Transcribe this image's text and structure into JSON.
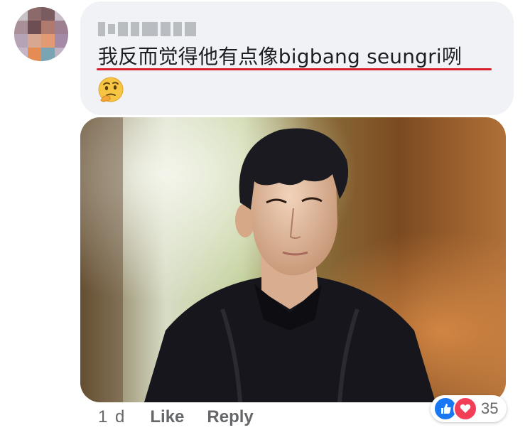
{
  "comment": {
    "text": "我反而觉得他有点像bigbang seungri咧",
    "emoji": "thinking-face"
  },
  "footer": {
    "time": "1 d",
    "like_label": "Like",
    "reply_label": "Reply"
  },
  "reactions": {
    "icons": [
      "like-icon",
      "love-icon"
    ],
    "count": "35"
  },
  "colors": {
    "bubble_bg": "#f0f2f5",
    "underline": "#d81e2c",
    "meta_text": "#65676b",
    "like_blue": "#1877f2",
    "love_red": "#f33e58"
  }
}
